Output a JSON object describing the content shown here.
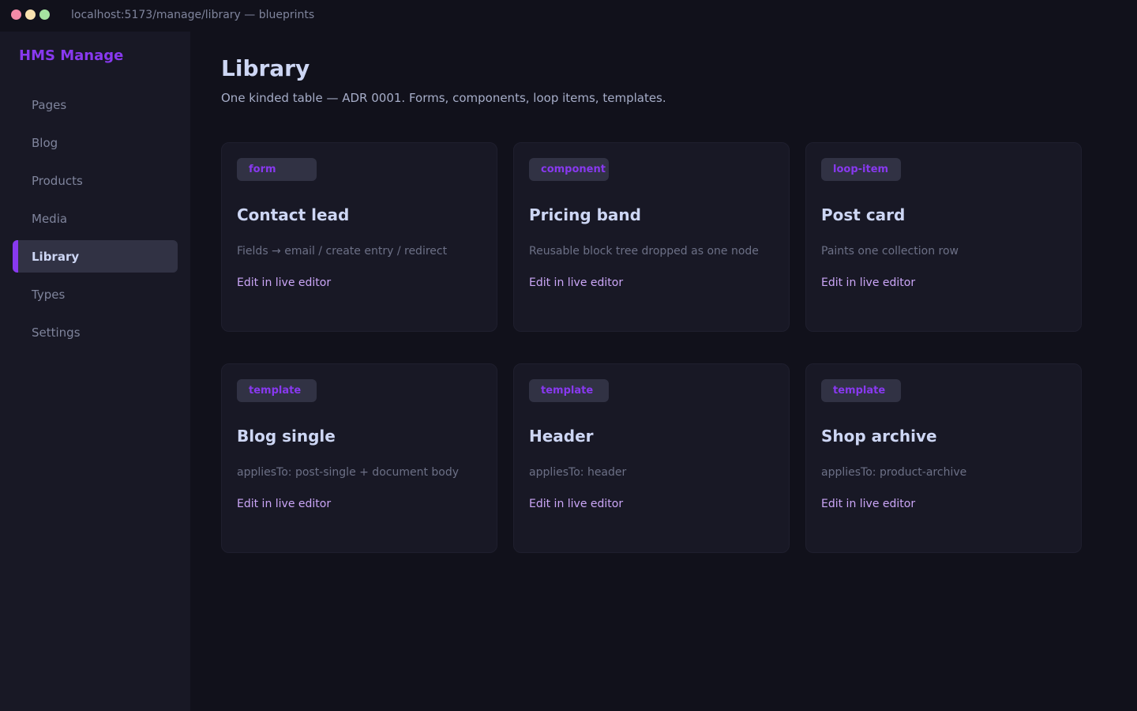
{
  "window": {
    "url": "localhost:5173/manage/library — blueprints"
  },
  "sidebar": {
    "brand": "HMS Manage",
    "items": [
      {
        "label": "Pages",
        "active": false
      },
      {
        "label": "Blog",
        "active": false
      },
      {
        "label": "Products",
        "active": false
      },
      {
        "label": "Media",
        "active": false
      },
      {
        "label": "Library",
        "active": true
      },
      {
        "label": "Types",
        "active": false
      },
      {
        "label": "Settings",
        "active": false
      }
    ]
  },
  "main": {
    "title": "Library",
    "subtitle": "One kinded table — ADR 0001. Forms, components, loop items, templates.",
    "cards": [
      {
        "kind": "form",
        "title": "Contact lead",
        "desc": "Fields → email / create entry / redirect",
        "link": "Edit in live editor"
      },
      {
        "kind": "component",
        "title": "Pricing band",
        "desc": "Reusable block tree dropped as one node",
        "link": "Edit in live editor"
      },
      {
        "kind": "loop-item",
        "title": "Post card",
        "desc": "Paints one collection row",
        "link": "Edit in live editor"
      },
      {
        "kind": "template",
        "title": "Blog single",
        "desc": "appliesTo: post-single + document body",
        "link": "Edit in live editor"
      },
      {
        "kind": "template",
        "title": "Header",
        "desc": "appliesTo: header",
        "link": "Edit in live editor"
      },
      {
        "kind": "template",
        "title": "Shop archive",
        "desc": "appliesTo: product-archive",
        "link": "Edit in live editor"
      }
    ]
  },
  "colors": {
    "accent": "#8839ef",
    "link": "#cba6f7",
    "background": "#11111b",
    "surface": "#181825"
  }
}
